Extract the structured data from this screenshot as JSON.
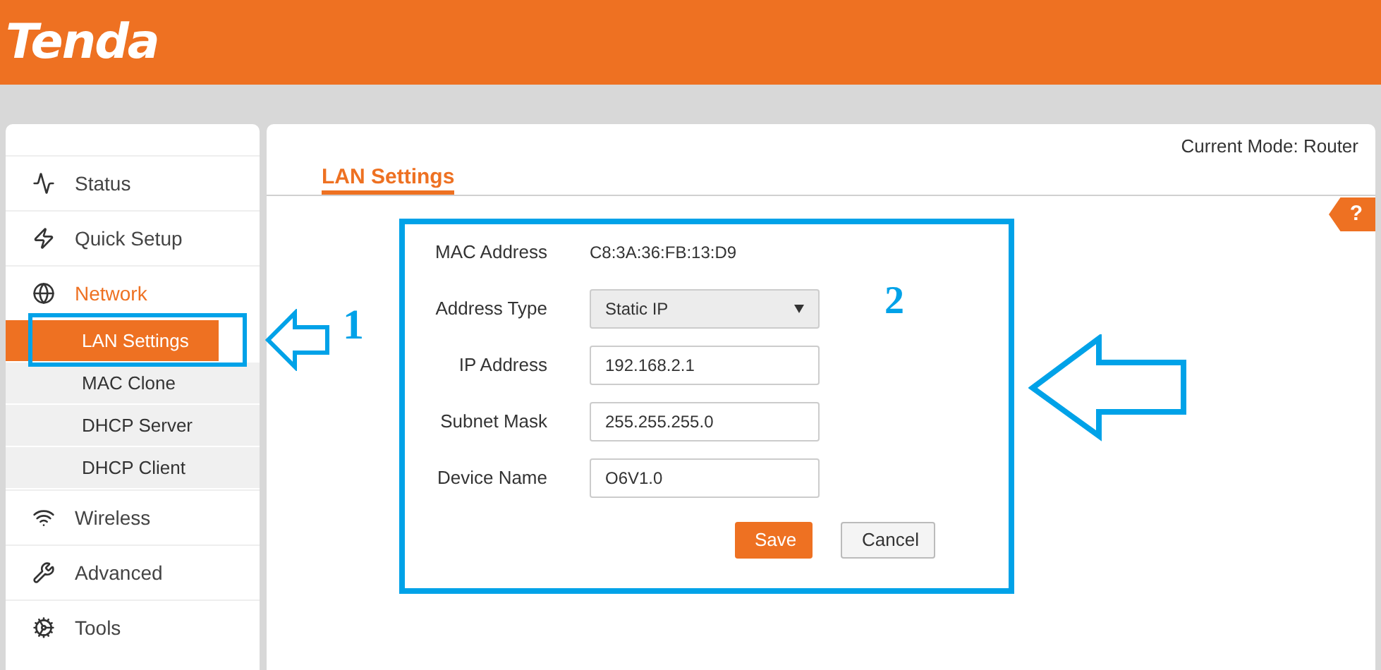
{
  "header": {
    "logo": "Tenda"
  },
  "sidebar": {
    "items": [
      {
        "label": "Status",
        "selected": false
      },
      {
        "label": "Quick Setup",
        "selected": false
      },
      {
        "label": "Network",
        "selected": true,
        "children": [
          {
            "label": "LAN Settings",
            "selected": true
          },
          {
            "label": "MAC Clone",
            "selected": false
          },
          {
            "label": "DHCP Server",
            "selected": false
          },
          {
            "label": "DHCP Client",
            "selected": false
          }
        ]
      },
      {
        "label": "Wireless",
        "selected": false
      },
      {
        "label": "Advanced",
        "selected": false
      },
      {
        "label": "Tools",
        "selected": false
      }
    ]
  },
  "main": {
    "mode": "Current Mode: Router",
    "title": "LAN Settings",
    "help": "?",
    "fields": [
      {
        "kind": "text",
        "label": "MAC Address",
        "value": "C8:3A:36:FB:13:D9"
      },
      {
        "kind": "select",
        "label": "Address Type",
        "value": "Static IP"
      },
      {
        "kind": "input",
        "label": "IP Address",
        "value": "192.168.2.1"
      },
      {
        "kind": "input",
        "label": "Subnet Mask",
        "value": "255.255.255.0"
      },
      {
        "kind": "input",
        "label": "Device Name",
        "value": "O6V1.0"
      }
    ],
    "buttons": [
      {
        "label": "Save",
        "kind": "primary"
      },
      {
        "label": "Cancel",
        "kind": "secondary"
      }
    ]
  },
  "annotations": [
    {
      "number": "1"
    },
    {
      "number": "2"
    }
  ]
}
